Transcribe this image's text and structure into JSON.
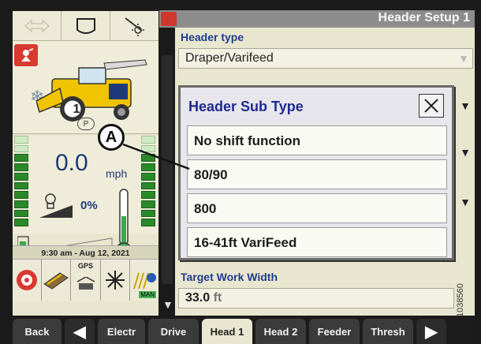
{
  "header": {
    "title": "Header Setup 1"
  },
  "form": {
    "header_type_label": "Header type",
    "header_type_value": "Draper/Varifeed",
    "target_width_label": "Target Work Width",
    "target_width_value": "33.0",
    "target_width_unit": "ft"
  },
  "modal": {
    "title": "Header Sub Type",
    "options": [
      "No shift function",
      "80/90",
      "800",
      "16-41ft VariFeed"
    ]
  },
  "status": {
    "speed": "0.0",
    "speed_unit": "mph",
    "engine_load": "0%",
    "datetime": "9:30 am - Aug 12, 2021",
    "gear": "1",
    "park": "P",
    "gps_label": "GPS",
    "man_label": "MAN"
  },
  "callout": {
    "label": "A"
  },
  "figure_code": "1038560",
  "tabs": [
    {
      "label": "Back"
    },
    {
      "label": "Electr"
    },
    {
      "label": "Drive"
    },
    {
      "label": "Head 1",
      "active": true
    },
    {
      "label": "Head 2"
    },
    {
      "label": "Feeder"
    },
    {
      "label": "Thresh"
    }
  ],
  "icons": [
    "wrench-icon",
    "combine-icon",
    "snowflake-icon",
    "engine-icon",
    "thermometer-icon",
    "fuel-icon",
    "gps-icon",
    "man-icon",
    "close-icon",
    "dropdown-arrow-icon"
  ]
}
